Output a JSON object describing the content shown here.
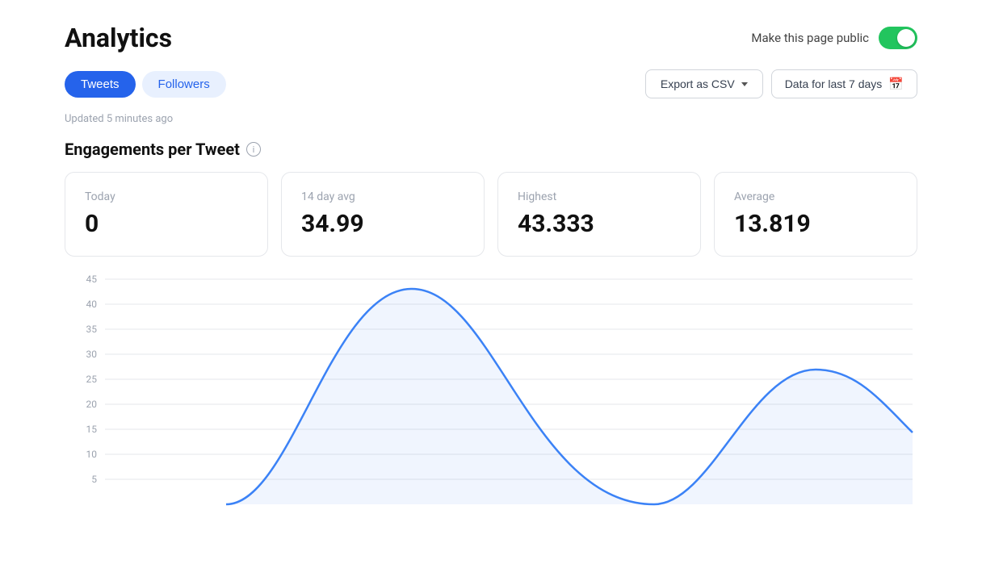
{
  "page": {
    "title": "Analytics"
  },
  "header": {
    "make_public_label": "Make this page public",
    "toggle_on": true
  },
  "tabs": [
    {
      "id": "tweets",
      "label": "Tweets",
      "active": true
    },
    {
      "id": "followers",
      "label": "Followers",
      "active": false
    }
  ],
  "actions": {
    "export_label": "Export as CSV",
    "data_range_label": "Data for last 7 days"
  },
  "updated": {
    "text": "Updated 5 minutes ago"
  },
  "section": {
    "title": "Engagements per Tweet",
    "info_char": "i"
  },
  "cards": [
    {
      "id": "today",
      "label": "Today",
      "value": "0"
    },
    {
      "id": "14day",
      "label": "14 day avg",
      "value": "34.99"
    },
    {
      "id": "highest",
      "label": "Highest",
      "value": "43.333"
    },
    {
      "id": "average",
      "label": "Average",
      "value": "13.819"
    }
  ],
  "chart": {
    "y_labels": [
      "45",
      "40",
      "35",
      "30",
      "25",
      "20",
      "15",
      "10",
      "5"
    ],
    "y_values": [
      45,
      40,
      35,
      30,
      25,
      20,
      15,
      10,
      5
    ],
    "colors": {
      "line": "#3b82f6",
      "area": "rgba(59,130,246,0.08)",
      "grid": "#e5e7eb"
    }
  }
}
